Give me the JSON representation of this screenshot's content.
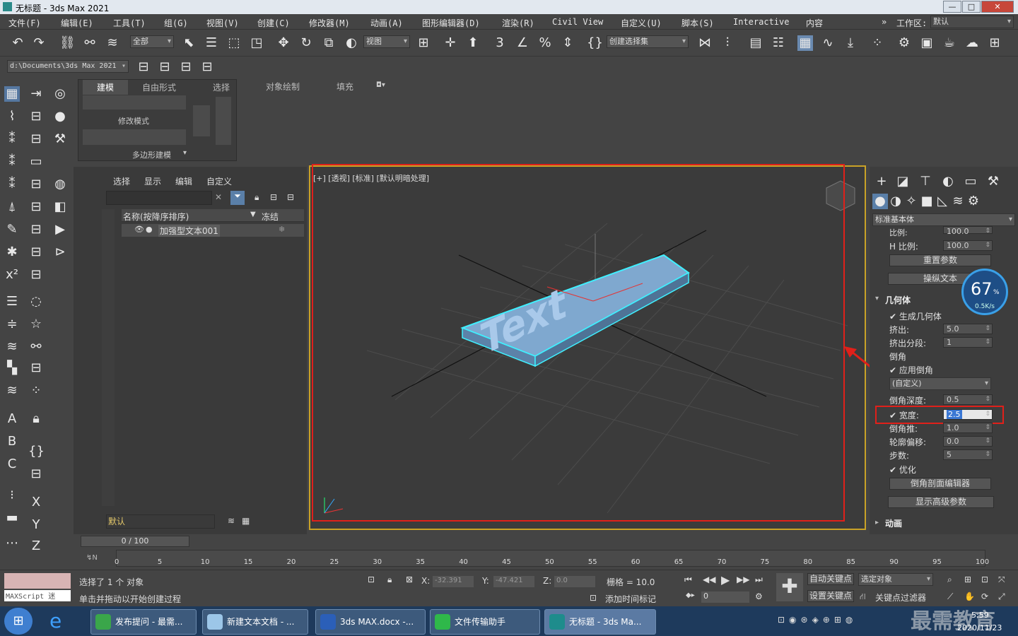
{
  "window": {
    "title": "无标题 - 3ds Max 2021",
    "controls": [
      "—",
      "□",
      "✕"
    ]
  },
  "menu": [
    "文件(F)",
    "编辑(E)",
    "工具(T)",
    "组(G)",
    "视图(V)",
    "创建(C)",
    "修改器(M)",
    "动画(A)",
    "图形编辑器(D)",
    "渲染(R)",
    "Civil View",
    "自定义(U)",
    "脚本(S)",
    "Interactive",
    "内容"
  ],
  "workspace": {
    "label": "工作区:",
    "value": "默认"
  },
  "toolbar": {
    "selection_filter": "全部",
    "ref_coord": "视图",
    "named_selection": "创建选择集",
    "path": "d:\\Documents\\3ds Max 2021"
  },
  "ribbon": {
    "tabs": [
      "建模",
      "自由形式",
      "选择",
      "对象绘制",
      "填充"
    ],
    "mode_label": "修改模式",
    "section_label": "多边形建模"
  },
  "scene_explorer": {
    "tabs": [
      "选择",
      "显示",
      "编辑",
      "自定义"
    ],
    "col_name": "名称(按降序排序)",
    "col_freeze": "冻结",
    "rows": [
      {
        "name": "加强型文本001"
      }
    ],
    "layer": "默认"
  },
  "viewport": {
    "label": "[+] [透视] [标准] [默认明暗处理]",
    "text_object": "Text"
  },
  "command_panel": {
    "dropdown": "标准基本体",
    "rows_top": [
      {
        "label": "比例:",
        "value": "100.0"
      },
      {
        "label": "H 比例:",
        "value": "100.0"
      }
    ],
    "reset_button": "重置参数",
    "manipulate_button": "操纵文本",
    "rollout_geometry": "几何体",
    "gen_geometry": "生成几何体",
    "extrude": {
      "label": "挤出:",
      "value": "5.0"
    },
    "extrude_segs": {
      "label": "挤出分段:",
      "value": "1"
    },
    "bevel_section": "倒角",
    "apply_bevel": "应用倒角",
    "bevel_preset": "(自定义)",
    "bevel_depth": {
      "label": "倒角深度:",
      "value": "0.5"
    },
    "width": {
      "label": "宽度:",
      "value": "2.5"
    },
    "bevel_push": {
      "label": "倒角推:",
      "value": "1.0"
    },
    "outline_offset": {
      "label": "轮廓偏移:",
      "value": "0.0"
    },
    "steps": {
      "label": "步数:",
      "value": "5"
    },
    "optimize": "优化",
    "profile_editor_button": "倒角剖面编辑器",
    "advanced_button": "显示高级参数",
    "rollout_anim": "动画"
  },
  "net_widget": {
    "percent": "67",
    "unit": "%",
    "speed": "0.5K/s"
  },
  "timeline": {
    "frame": "0 / 100",
    "ticks": [
      "0",
      "5",
      "10",
      "15",
      "20",
      "25",
      "30",
      "35",
      "40",
      "45",
      "50",
      "55",
      "60",
      "65",
      "70",
      "75",
      "80",
      "85",
      "90",
      "95",
      "100"
    ]
  },
  "status": {
    "maxscript": "MAXScript 迷",
    "selected": "选择了 1 个 对象",
    "prompt": "单击并拖动以开始创建过程",
    "x_label": "X:",
    "x": "-32.391",
    "y_label": "Y:",
    "y": "-47.421",
    "z_label": "Z:",
    "z": "0.0",
    "grid": "栅格 = 10.0",
    "add_time_tag": "添加时间标记",
    "autokey": "自动关键点",
    "setkey": "设置关键点",
    "sel_obj": "选定对象",
    "key_filter": "关键点过滤器",
    "frame_field": "0"
  },
  "taskbar": {
    "items": [
      "发布提问 - 最需...",
      "新建文本文档 - ...",
      "3ds MAX.docx -...",
      "文件传输助手",
      "无标题 - 3ds Ma..."
    ],
    "time": "5:59",
    "date": "2020/11/23",
    "watermark": "最需教育"
  },
  "colors": {
    "highlight": "#e0201a",
    "text_object": "#8fb8e0",
    "selection_outline": "#3ff0ff",
    "viewport_border": "#c9a227"
  }
}
